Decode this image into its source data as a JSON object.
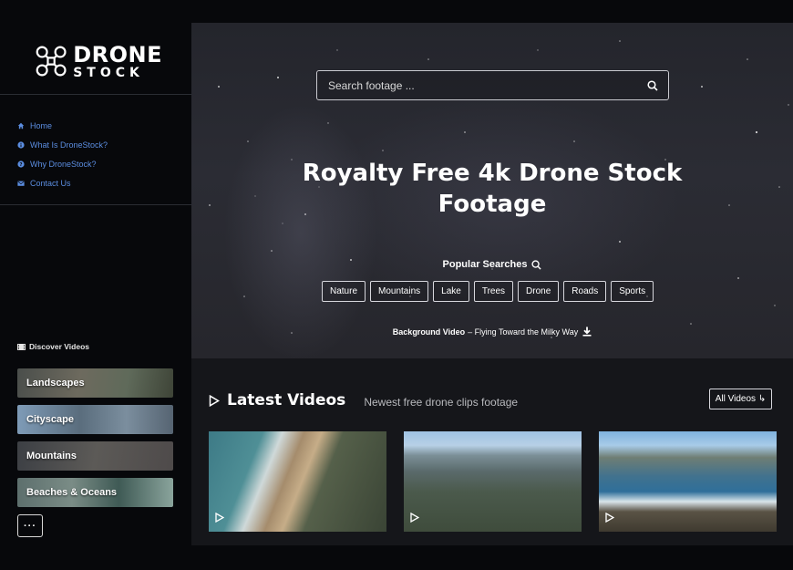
{
  "brand": {
    "line1": "DRONE",
    "line2": "STOCK",
    "icon": "drone-logo-icon"
  },
  "sidebar": {
    "nav": [
      {
        "label": "Home",
        "icon": "home-icon"
      },
      {
        "label": "What Is DroneStock?",
        "icon": "info-icon"
      },
      {
        "label": "Why DroneStock?",
        "icon": "question-icon"
      },
      {
        "label": "Contact Us",
        "icon": "envelope-icon"
      }
    ],
    "discover_title": "Discover Videos",
    "categories": [
      {
        "label": "Landscapes"
      },
      {
        "label": "Cityscape"
      },
      {
        "label": "Mountains"
      },
      {
        "label": "Beaches & Oceans"
      }
    ],
    "more_label": "···"
  },
  "hero": {
    "search_placeholder": "Search footage ...",
    "title_line1": "Royalty Free 4k Drone Stock",
    "title_line2": "Footage",
    "popular_title": "Popular Searches",
    "tags": [
      "Nature",
      "Mountains",
      "Lake",
      "Trees",
      "Drone",
      "Roads",
      "Sports"
    ],
    "bg_video_label": "Background Video",
    "bg_video_title": "– Flying Toward the Milky Way"
  },
  "latest": {
    "title": "Latest Videos",
    "subtitle": "Newest free drone clips footage",
    "all_label": "All Videos ↳"
  },
  "colors": {
    "link": "#5b8de0",
    "background": "#07080b",
    "panel": "#15161a"
  }
}
